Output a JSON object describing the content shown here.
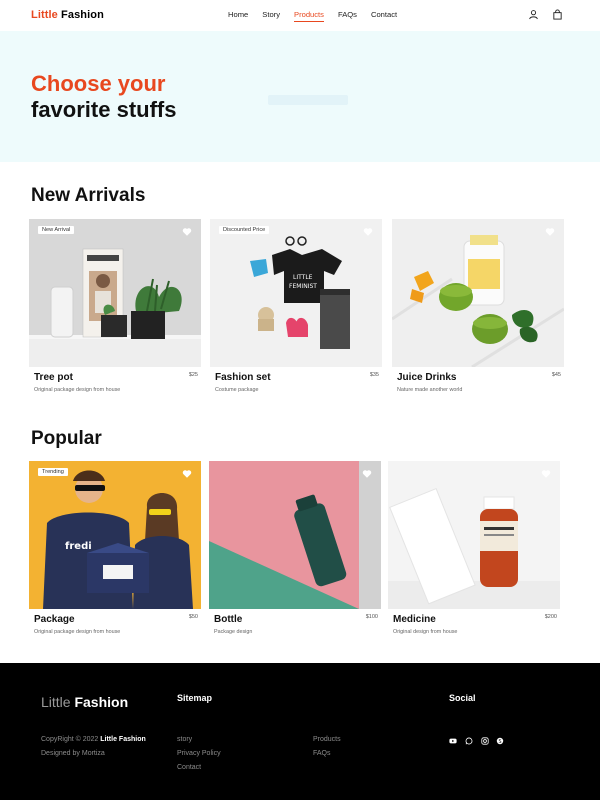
{
  "nav": {
    "brand_accent": "Little",
    "brand_rest": " Fashion",
    "links": [
      "Home",
      "Story",
      "Products",
      "FAQs",
      "Contact"
    ],
    "active": "Products",
    "icons": [
      "user-icon",
      "bag-icon"
    ]
  },
  "hero": {
    "line1": "Choose your",
    "line2": "favorite stuffs"
  },
  "new_arrivals": {
    "title": "New Arrivals",
    "items": [
      {
        "tag": "New Arrival",
        "name": "Tree pot",
        "price": "$25",
        "desc": "Original package design from house"
      },
      {
        "tag": "Discounted Price",
        "name": "Fashion set",
        "price": "$35",
        "desc": "Costume package"
      },
      {
        "tag": "",
        "name": "Juice Drinks",
        "price": "$45",
        "desc": "Nature made another world"
      }
    ]
  },
  "popular": {
    "title": "Popular",
    "items": [
      {
        "tag": "Trending",
        "name": "Package",
        "price": "$50",
        "desc": "Original package design from house"
      },
      {
        "tag": "",
        "name": "Bottle",
        "price": "$100",
        "desc": "Package design"
      },
      {
        "tag": "",
        "name": "Medicine",
        "price": "$200",
        "desc": "Original design from house"
      }
    ]
  },
  "footer": {
    "brand_light": "Little",
    "brand_bold": " Fashion",
    "copyright_prefix": "CopyRight © 2022 ",
    "copyright_brand": "Little Fashion",
    "designed_by": "Designed by Mortiza",
    "sitemap_title": "Sitemap",
    "sitemap_col1": [
      "story",
      "Privacy Policy",
      "Contact"
    ],
    "sitemap_col2": [
      "Products",
      "FAQs"
    ],
    "social_title": "Social",
    "social_icons": [
      "youtube-icon",
      "whatsapp-icon",
      "instagram-icon",
      "skype-icon"
    ]
  },
  "colors": {
    "accent": "#e8481f",
    "hero_bg": "#eefbfc",
    "footer_bg": "#000000"
  }
}
